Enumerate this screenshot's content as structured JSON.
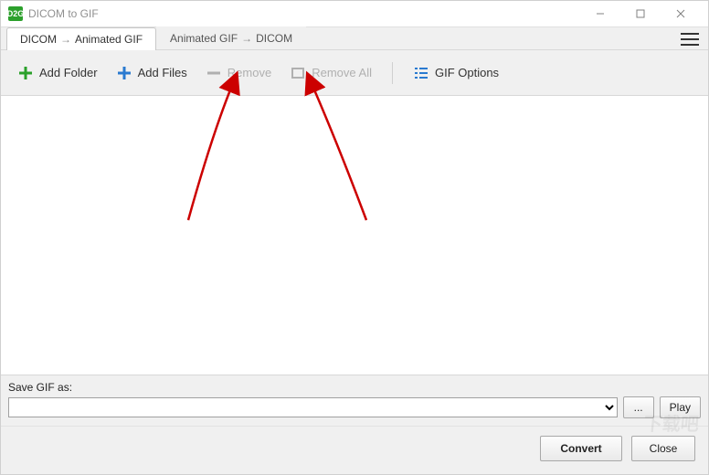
{
  "window": {
    "title": "DICOM to GIF",
    "app_icon_text": "D2G"
  },
  "tabs": [
    {
      "from": "DICOM",
      "to": "Animated GIF",
      "active": true
    },
    {
      "from": "Animated GIF",
      "to": "DICOM",
      "active": false
    }
  ],
  "toolbar": {
    "add_folder": "Add Folder",
    "add_files": "Add Files",
    "remove": "Remove",
    "remove_all": "Remove All",
    "gif_options": "GIF Options"
  },
  "bottom": {
    "save_label": "Save GIF as:",
    "path_value": "",
    "browse_label": "...",
    "play_label": "Play",
    "convert_label": "Convert",
    "close_label": "Close"
  },
  "watermark": "下载吧"
}
